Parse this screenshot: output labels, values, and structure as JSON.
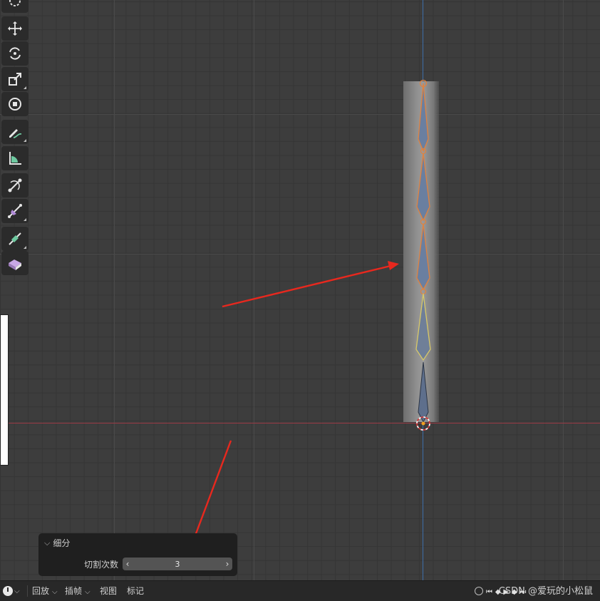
{
  "operator_panel": {
    "title": "细分",
    "collapse_icon": "chevron-down-icon",
    "field_label": "切割次数",
    "field_value": "3",
    "decrement": "‹",
    "increment": "›"
  },
  "status_bar": {
    "editor_type_icon": "clock-icon",
    "menus": [
      "回放",
      "插帧",
      "视图",
      "标记"
    ],
    "playback_icons": [
      "record-icon",
      "jump-start-icon",
      "prev-keyframe-icon",
      "play-icon",
      "next-keyframe-icon",
      "jump-end-icon"
    ],
    "watermark": "CSDN @爱玩的小松鼠"
  },
  "toolbar": {
    "tools": [
      "cursor-icon",
      "move-icon",
      "rotate-icon",
      "scale-icon",
      "transform-icon",
      "annotate-icon",
      "measure-icon",
      "bone-roll-icon",
      "bone-size-icon",
      "envelope-icon",
      "extrude-icon"
    ]
  },
  "colors": {
    "background": "#3d3d3d",
    "x_axis": "#9a3a44",
    "y_axis": "#3e6ea8",
    "selected_bone": "#e0823f",
    "active_bone": "#d8c867",
    "annotation_arrow": "#e8281e"
  }
}
